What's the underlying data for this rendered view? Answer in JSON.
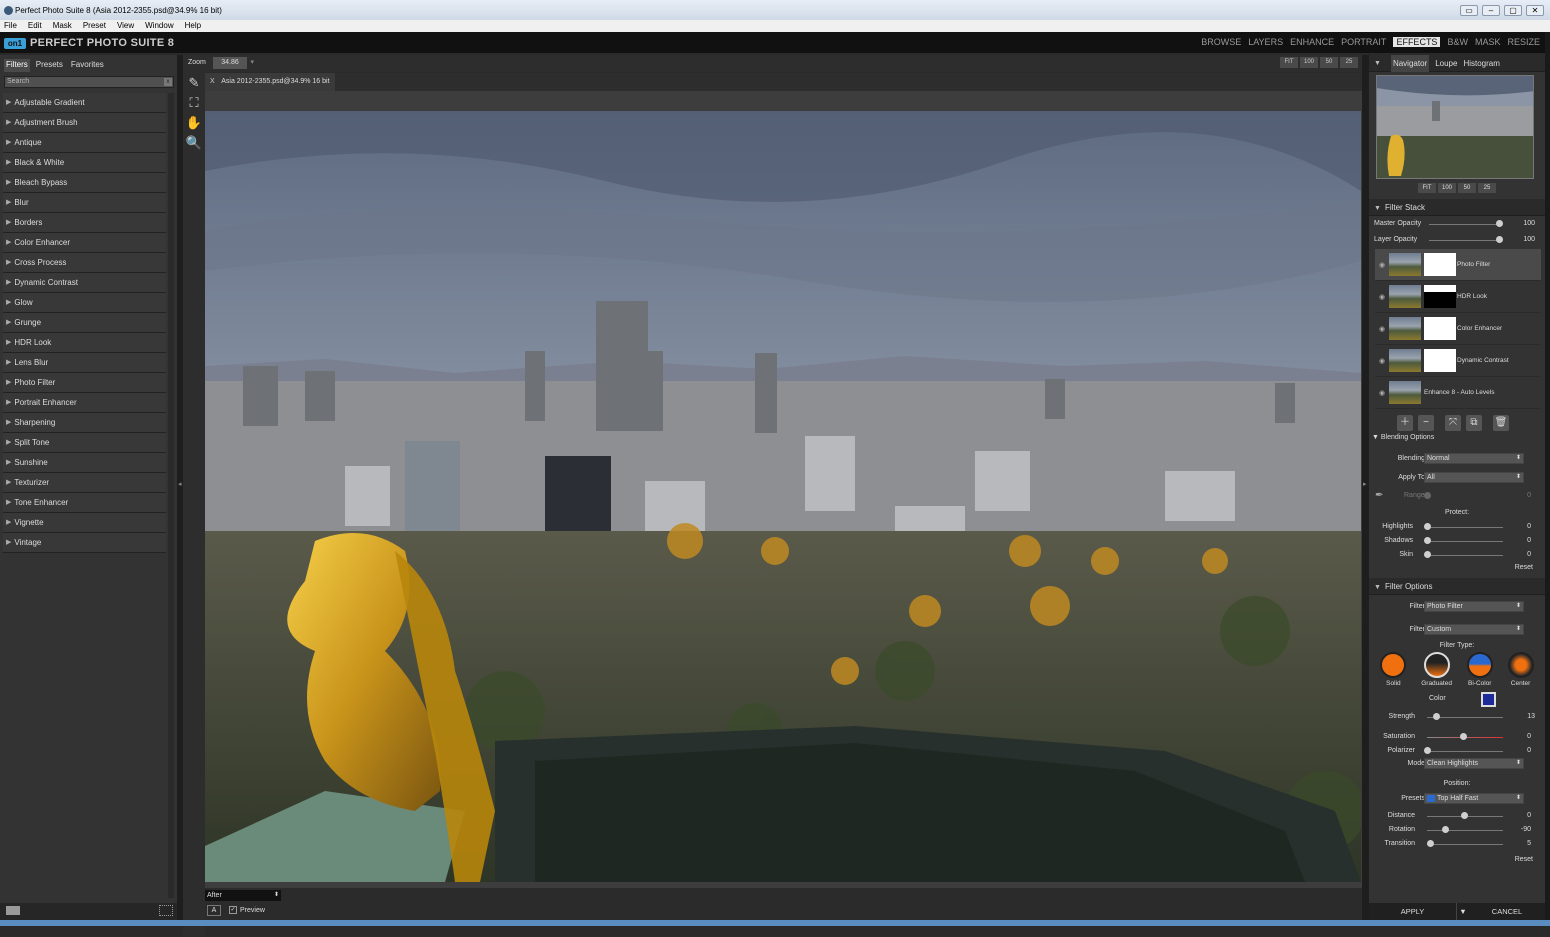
{
  "window": {
    "title": "Perfect Photo Suite 8 (Asia 2012-2355.psd@34.9% 16 bit)"
  },
  "menu": [
    "File",
    "Edit",
    "Mask",
    "Preset",
    "View",
    "Window",
    "Help"
  ],
  "header": {
    "logo_mark": "on1",
    "logo_text": "PERFECT PHOTO SUITE 8",
    "modules": [
      "BROWSE",
      "LAYERS",
      "ENHANCE",
      "PORTRAIT",
      "EFFECTS",
      "B&W",
      "MASK",
      "RESIZE"
    ],
    "active_module": "EFFECTS"
  },
  "left": {
    "tabs": [
      "Filters",
      "Presets",
      "Favorites"
    ],
    "active_tab": "Filters",
    "search_placeholder": "Search",
    "search_clear": "x",
    "filters": [
      "Adjustable Gradient",
      "Adjustment Brush",
      "Antique",
      "Black & White",
      "Bleach Bypass",
      "Blur",
      "Borders",
      "Color Enhancer",
      "Cross Process",
      "Dynamic Contrast",
      "Glow",
      "Grunge",
      "HDR Look",
      "Lens Blur",
      "Photo Filter",
      "Portrait Enhancer",
      "Sharpening",
      "Split Tone",
      "Sunshine",
      "Texturizer",
      "Tone Enhancer",
      "Vignette",
      "Vintage"
    ]
  },
  "zoom": {
    "label": "Zoom",
    "value": "34.86",
    "buttons": [
      "FIT",
      "100",
      "50",
      "25"
    ]
  },
  "document": {
    "close": "X",
    "tab": "Asia 2012-2355.psd@34.9% 16 bit"
  },
  "bottom": {
    "view_mode": "After",
    "a_label": "A",
    "preview_label": "Preview",
    "preview_checked": "✓"
  },
  "navigator": {
    "tabs": [
      "Navigator",
      "Loupe",
      "Histogram"
    ],
    "active": "Navigator",
    "buttons": [
      "FIT",
      "100",
      "50",
      "25"
    ]
  },
  "filter_stack": {
    "title": "Filter Stack",
    "master_label": "Master Opacity",
    "master_value": "100",
    "layer_label": "Layer Opacity",
    "layer_value": "100",
    "layers": [
      "Photo Filter",
      "HDR Look",
      "Color Enhancer",
      "Dynamic Contrast",
      "Enhance 8 - Auto Levels"
    ]
  },
  "blending": {
    "title": "Blending Options",
    "blending_label": "Blending",
    "blending_value": "Normal",
    "apply_label": "Apply To",
    "apply_value": "All",
    "range_label": "Range",
    "range_value": "0",
    "protect_label": "Protect:",
    "highlights_label": "Highlights",
    "highlights_value": "0",
    "shadows_label": "Shadows",
    "shadows_value": "0",
    "skin_label": "Skin",
    "skin_value": "0",
    "reset": "Reset"
  },
  "filter_options": {
    "title": "Filter Options",
    "filter_label": "Filter",
    "filter_value": "Photo Filter",
    "filter2_label": "Filter",
    "filter2_value": "Custom",
    "filter_type_label": "Filter Type:",
    "types": [
      "Solid",
      "Graduated",
      "Bi-Color",
      "Center"
    ],
    "color_label": "Color",
    "strength_label": "Strength",
    "strength_value": "13",
    "saturation_label": "Saturation",
    "saturation_value": "0",
    "polarizer_label": "Polarizer",
    "polarizer_value": "0",
    "mode_label": "Mode",
    "mode_value": "Clean Highlights",
    "position_label": "Position:",
    "presets_label": "Presets",
    "presets_value": "Top Half Fast",
    "distance_label": "Distance",
    "distance_value": "0",
    "rotation_label": "Rotation",
    "rotation_value": "-90",
    "transition_label": "Transition",
    "transition_value": "5",
    "reset": "Reset"
  },
  "actions": {
    "apply": "APPLY",
    "arrow": "▼",
    "cancel": "CANCEL"
  }
}
